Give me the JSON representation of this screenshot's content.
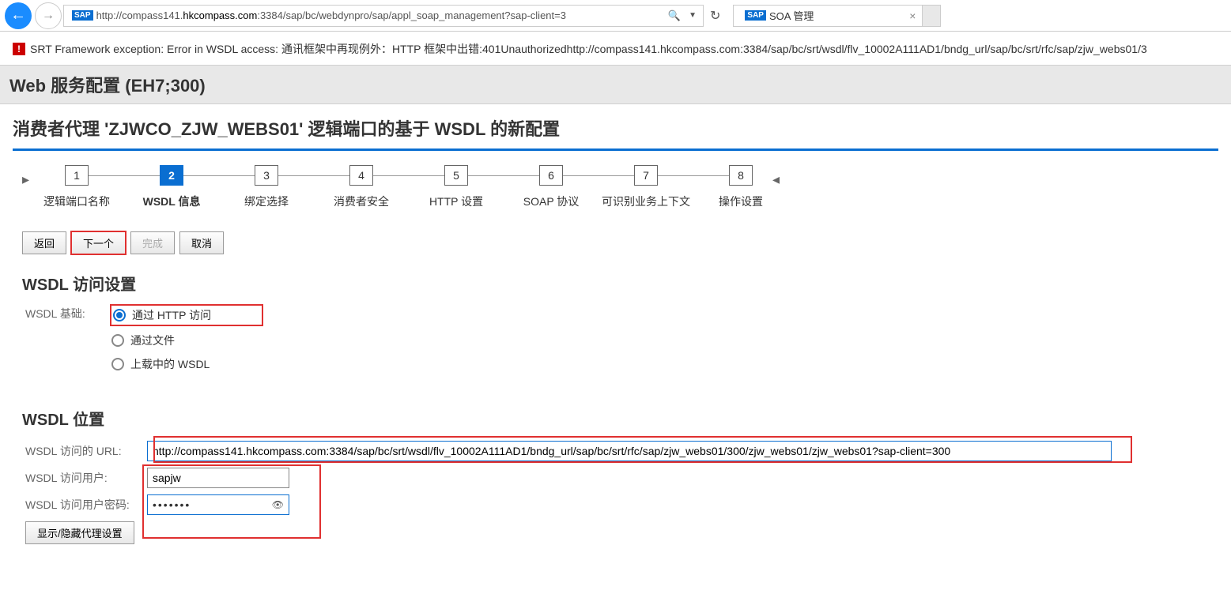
{
  "browser": {
    "url_prefix": "http://compass141.",
    "url_host": "hkcompass.com",
    "url_suffix": ":3384/sap/bc/webdynpro/sap/appl_soap_management?sap-client=3",
    "sap_badge": "SAP",
    "tab_title": "SOA 管理"
  },
  "error": {
    "text": "SRT Framework exception: Error in WSDL access: 通讯框架中再现例外：HTTP 框架中出错:401Unauthorizedhttp://compass141.hkcompass.com:3384/sap/bc/srt/wsdl/flv_10002A111AD1/bndg_url/sap/bc/srt/rfc/sap/zjw_webs01/3"
  },
  "page_title": "Web 服务配置 (EH7;300)",
  "sub_title": "消费者代理 'ZJWCO_ZJW_WEBS01' 逻辑端口的基于 WSDL 的新配置",
  "wizard": {
    "steps": [
      {
        "num": "1",
        "label": "逻辑端口名称"
      },
      {
        "num": "2",
        "label": "WSDL 信息"
      },
      {
        "num": "3",
        "label": "绑定选择"
      },
      {
        "num": "4",
        "label": "消费者安全"
      },
      {
        "num": "5",
        "label": "HTTP 设置"
      },
      {
        "num": "6",
        "label": "SOAP 协议"
      },
      {
        "num": "7",
        "label": "可识别业务上下文"
      },
      {
        "num": "8",
        "label": "操作设置"
      }
    ],
    "active": 1
  },
  "buttons": {
    "back": "返回",
    "next": "下一个",
    "finish": "完成",
    "cancel": "取消"
  },
  "wsdl_access": {
    "title": "WSDL 访问设置",
    "basis_label": "WSDL 基础:",
    "opt_http": "通过 HTTP 访问",
    "opt_file": "通过文件",
    "opt_upload": "上载中的 WSDL"
  },
  "wsdl_location": {
    "title": "WSDL 位置",
    "url_label": "WSDL 访问的 URL:",
    "url_value": "http://compass141.hkcompass.com:3384/sap/bc/srt/wsdl/flv_10002A111AD1/bndg_url/sap/bc/srt/rfc/sap/zjw_webs01/300/zjw_webs01/zjw_webs01?sap-client=300",
    "user_label": "WSDL 访问用户:",
    "user_value": "sapjw",
    "pwd_label": "WSDL 访问用户密码:",
    "pwd_value": "•••••••",
    "proxy_btn": "显示/隐藏代理设置"
  }
}
